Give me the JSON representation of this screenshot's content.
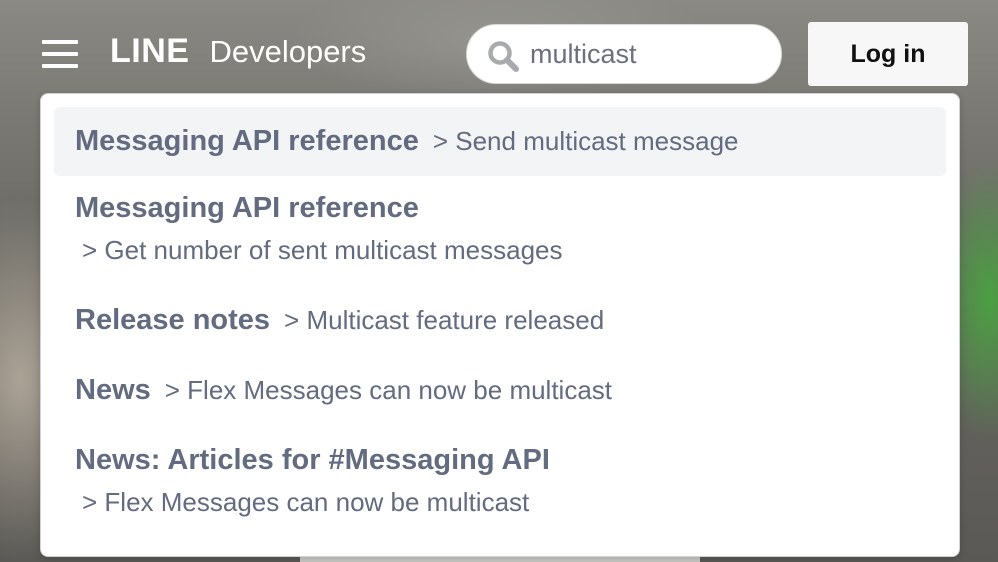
{
  "header": {
    "logo_brand": "LINE",
    "logo_product": "Developers",
    "login_label": "Log in"
  },
  "search": {
    "value": "multicast"
  },
  "results": [
    {
      "title": "Messaging API reference",
      "subtitle": "> Send multicast message"
    },
    {
      "title": "Messaging API reference",
      "subtitle": "> Get number of sent multicast messages"
    },
    {
      "title": "Release notes",
      "subtitle": "> Multicast feature released"
    },
    {
      "title": "News",
      "subtitle": "> Flex Messages can now be multicast"
    },
    {
      "title": "News: Articles for #Messaging API",
      "subtitle": "> Flex Messages can now be multicast"
    }
  ],
  "colors": {
    "result_text": "#626b7f",
    "active_row": "#f3f4f6",
    "login_text": "#111111"
  },
  "icons": {
    "menu": "hamburger-menu-icon",
    "search": "search-icon"
  }
}
